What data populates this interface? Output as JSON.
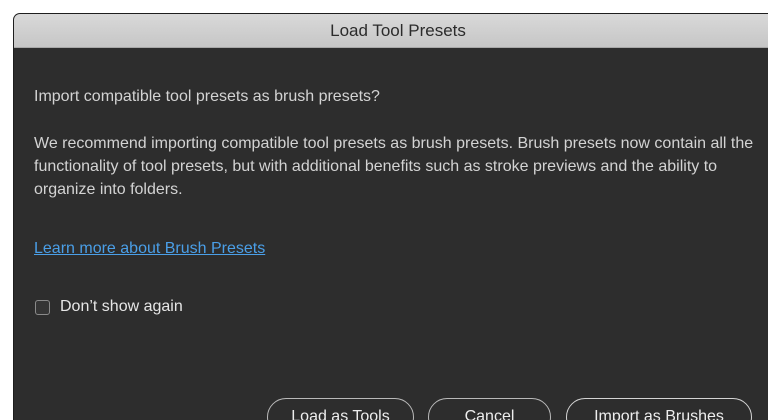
{
  "dialog": {
    "title": "Load Tool Presets",
    "question": "Import compatible tool presets as brush presets?",
    "body": "We recommend importing compatible tool presets as brush presets. Brush presets now contain all the functionality of tool presets, but with additional benefits such as stroke previews and the ability to organize into folders.",
    "link_text": "Learn more about Brush Presets",
    "checkbox_label": "Don’t show again",
    "checkbox_checked": false
  },
  "buttons": {
    "load_as_tools": "Load as Tools",
    "cancel": "Cancel",
    "import_as_brushes": "Import as Brushes"
  },
  "colors": {
    "background": "#2d2d2d",
    "titlebar": "#d0d0d0",
    "text": "#d3d3d3",
    "link": "#4a9fe8"
  }
}
